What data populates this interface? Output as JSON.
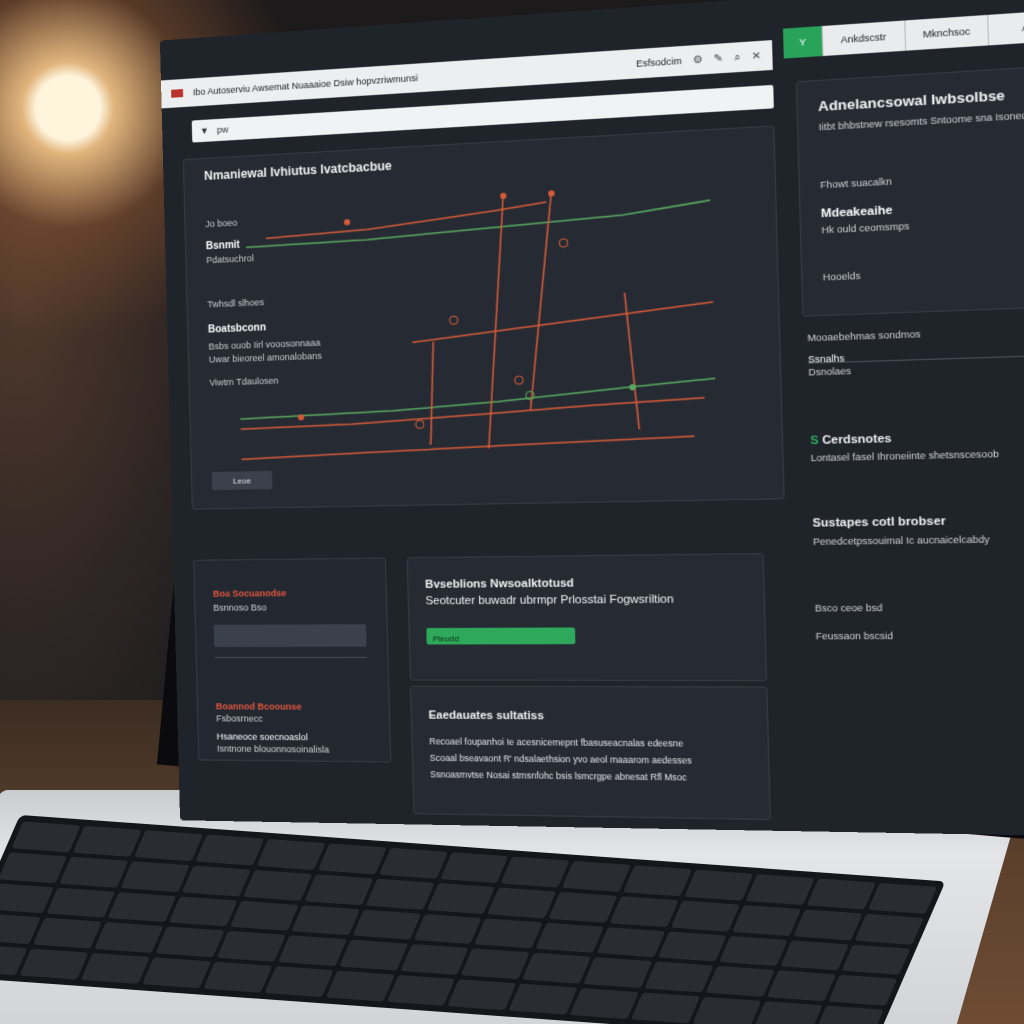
{
  "topbar": {
    "path": "Ibo  Autoserviu Awsemat  Nuaaaioe  Dsiw  hopvzriwmunsi",
    "control_label": "Esfsodcim",
    "icons": [
      "gear-icon",
      "edit-icon",
      "search-icon",
      "close-icon"
    ]
  },
  "right_tabs": [
    "Y",
    "Ankdscstr",
    "Mknchsoc",
    "Ahy"
  ],
  "search": {
    "value": "pw"
  },
  "chart": {
    "title": "Nmaniewal Ivhiutus Ivatcbacbue",
    "side_labels": [
      "Jo boeo",
      "Bsnmit",
      "Pdatsuchrol",
      "Twhsdl slhoes",
      "Boatsbconn",
      "Bsbs ouob Iirl vooosonnaaa",
      "Uwar bieoreel amonalobans",
      "Viwtm Tdaulosen"
    ],
    "button_label": "Leoe"
  },
  "info_panel": {
    "title": "Adnelancsowal Iwbsolbse",
    "subtitle": "Iitbt bhbstnew rsesomts Sntoome sna Isoned",
    "section_label": "Fhowt suacalkn",
    "section_title": "Mdeakeaihe",
    "section_text": "Hk ould ceomsmps",
    "footer": "Hooelds"
  },
  "right_column": {
    "heading_label": "Mooaebehmas sondmos",
    "field_label": "Ssnalhs",
    "field_value": "Dsnolaes",
    "status_title": "Cerdsnotes",
    "status_text": "Lontasel fasel Ihroneiinte shetsnscesoob",
    "section_title": "Sustapes cotl brobser",
    "section_text": "Penedcetpssouimal Ic aucnaicelcabdy",
    "item_1": "Bsco ceoe bsd",
    "item_2": "Feussaon bscsid",
    "icon_label": "A"
  },
  "mid_panel": {
    "title": "Bvseblions Nwsoalktotusd",
    "subtitle": "Seotcuter buwadr ubrmpr Prlosstai Fogwsriltion",
    "progress": 1.0,
    "progress_label": "Pleudd"
  },
  "left_panel": {
    "title": "Boa Socuanodse",
    "subtitle": "Bsnnoso Bso",
    "alert_title": "Boannod Bcoounse",
    "alert_sub": "Fsbosrnecc",
    "text_1": "Hsaneoce  soecnoaslol",
    "text_2": "Isntnone blouonnosoinalisla"
  },
  "bottom_panel": {
    "title": "Eaedauates sultatiss",
    "line_1": "Recoael foupanhoi Ie  acesnicemepnt fbasuseacnalas edeesne",
    "line_2": "Scoaal bseavaont R' ndsalaethsion yvo aeol maaarom aedesses",
    "line_3": "Ssnoasmvtse Nosai stmsnfohc bsis  lsmcrgpe abnesat Rfl Msoc"
  },
  "colors": {
    "accent_green": "#2ea85b",
    "pipe_orange": "#d65a3a",
    "pipe_green": "#58a860",
    "alert_red": "#e0563f",
    "screen_bg": "#1f232a"
  }
}
